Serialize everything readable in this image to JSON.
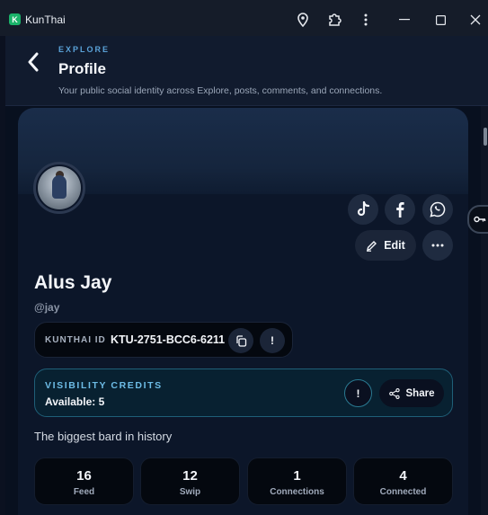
{
  "window": {
    "app_logo_letter": "K",
    "title": "KunThai",
    "icons": [
      "location-pin-icon",
      "extension-puzzle-icon",
      "kebab-menu-icon",
      "minimize-icon",
      "maximize-icon",
      "close-icon"
    ]
  },
  "header": {
    "eyebrow": "EXPLORE",
    "title": "Profile",
    "subtitle": "Your public social identity across Explore, posts, comments, and connections."
  },
  "profile": {
    "name": "Alus Jay",
    "handle": "@jay",
    "social": [
      "tiktok-icon",
      "facebook-icon",
      "whatsapp-icon"
    ],
    "edit_label": "Edit",
    "id_label": "KUNTHAI ID",
    "id_value": "KTU-2751-BCC6-6211",
    "id_info_glyph": "!",
    "bio": "The biggest bard in history"
  },
  "visibility": {
    "title": "VISIBILITY CREDITS",
    "available": "Available: 5",
    "info_glyph": "!",
    "share_label": "Share"
  },
  "stats": [
    {
      "value": "16",
      "label": "Feed"
    },
    {
      "value": "12",
      "label": "Swip"
    },
    {
      "value": "1",
      "label": "Connections"
    },
    {
      "value": "4",
      "label": "Connected"
    }
  ],
  "colors": {
    "accent": "#5aa2d8",
    "credits_accent": "#6dbce6",
    "background": "#0c1629"
  }
}
